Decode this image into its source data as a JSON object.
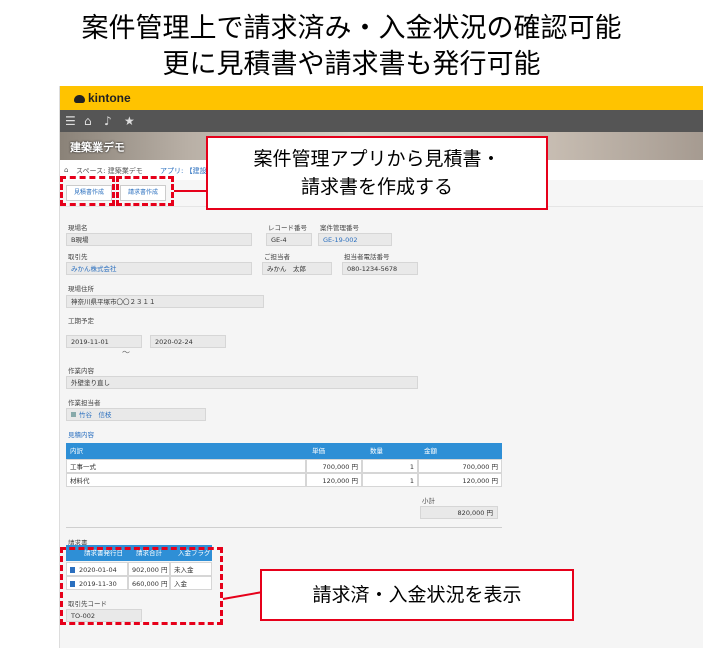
{
  "headline": {
    "line1": "案件管理上で請求済み・入金状況の確認可能",
    "line2": "更に見積書や請求書も発行可能"
  },
  "app": {
    "logo": "kintone",
    "banner_title": "建築業デモ",
    "breadcrumb": {
      "home": "⌂",
      "space": "スペース: 建築業デモ",
      "app": "アプリ: 【建設"
    },
    "actions": {
      "estimate_button": "見積書作成",
      "invoice_button": "請求書作成"
    }
  },
  "record": {
    "site_name_label": "現場名",
    "site_name": "B現場",
    "record_no_label": "レコード番号",
    "record_no": "GE-4",
    "case_no_label": "案件管理番号",
    "case_no": "GE-19-002",
    "client_label": "取引先",
    "client": "みかん株式会社",
    "contact_label": "ご担当者",
    "contact": "みかん　太郎",
    "contact_phone_label": "担当者電話番号",
    "contact_phone": "080-1234-5678",
    "address_label": "現場住所",
    "address": "神奈川県平塚市〇〇２３１１",
    "schedule_label": "工期予定",
    "start_date": "2019-11-01",
    "tilde": "～",
    "end_date": "2020-02-24",
    "work_label": "作業内容",
    "work": "外壁塗り直し",
    "staff_label": "作業担当者",
    "staff": "竹谷　信枝",
    "estimate_section_link": "見積内容"
  },
  "estimate_table": {
    "headers": [
      "内訳",
      "単価",
      "数量",
      "金額"
    ],
    "rows": [
      {
        "item": "工事一式",
        "unit_price": "700,000 円",
        "qty": "1",
        "amount": "700,000 円"
      },
      {
        "item": "材料代",
        "unit_price": "120,000 円",
        "qty": "1",
        "amount": "120,000 円"
      }
    ],
    "subtotal_label": "小計",
    "subtotal": "820,000 円"
  },
  "invoice_table": {
    "section_label": "請求書",
    "headers": [
      "請求書発行日",
      "請求合計",
      "入金フラグ"
    ],
    "rows": [
      {
        "date": "2020-01-04",
        "total": "902,000 円",
        "flag": "未入金"
      },
      {
        "date": "2019-11-30",
        "total": "660,000 円",
        "flag": "入金"
      }
    ]
  },
  "footer_fields": {
    "client_code_label": "取引先コード",
    "client_code": "TO-002"
  },
  "callouts": {
    "top": "案件管理アプリから見積書・\n請求書を作成する",
    "bottom": "請求済・入金状況を表示"
  },
  "accent_colors": {
    "kintone_yellow": "#ffc300",
    "annotation_red": "#e6001a",
    "table_header_blue": "#2e8fd6",
    "link_blue": "#2a6fbf"
  },
  "icons": [
    "menu-icon",
    "home-icon",
    "bell-icon",
    "star-icon",
    "document-icon",
    "user-icon"
  ]
}
